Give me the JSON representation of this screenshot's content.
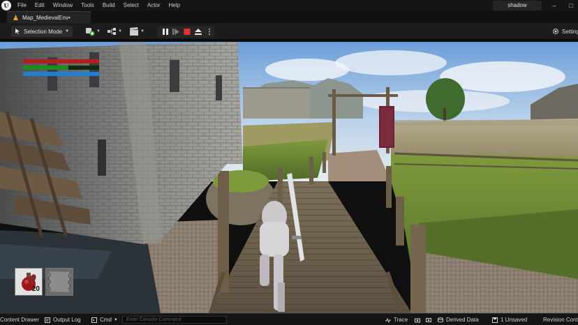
{
  "menu": {
    "items": [
      "File",
      "Edit",
      "Window",
      "Tools",
      "Build",
      "Select",
      "Actor",
      "Help"
    ],
    "project_name": "shadow"
  },
  "tab": {
    "label": "Map_MedievalEnv•"
  },
  "toolbar": {
    "mode_label": "Selection Mode",
    "settings_label": "Settings"
  },
  "hud": {
    "health_level": 1.0,
    "stamina_level": 0.6,
    "mana_level": 1.0,
    "colors": {
      "health": "#b61e1e",
      "stamina": "#1f8a24",
      "mana": "#1f7fd2"
    }
  },
  "inventory": {
    "slot1": {
      "icon": "health-potion-icon",
      "count": "20"
    },
    "slot2": {
      "icon": "cloth-item-icon"
    }
  },
  "statusbar": {
    "content_drawer": "Content Drawer",
    "output_log": "Output Log",
    "cmd": "Cmd",
    "console_placeholder": "Enter Console Command",
    "trace": "Trace",
    "derived_data": "Derived Data",
    "unsaved": "1 Unsaved",
    "revision_control": "Revision Control"
  }
}
